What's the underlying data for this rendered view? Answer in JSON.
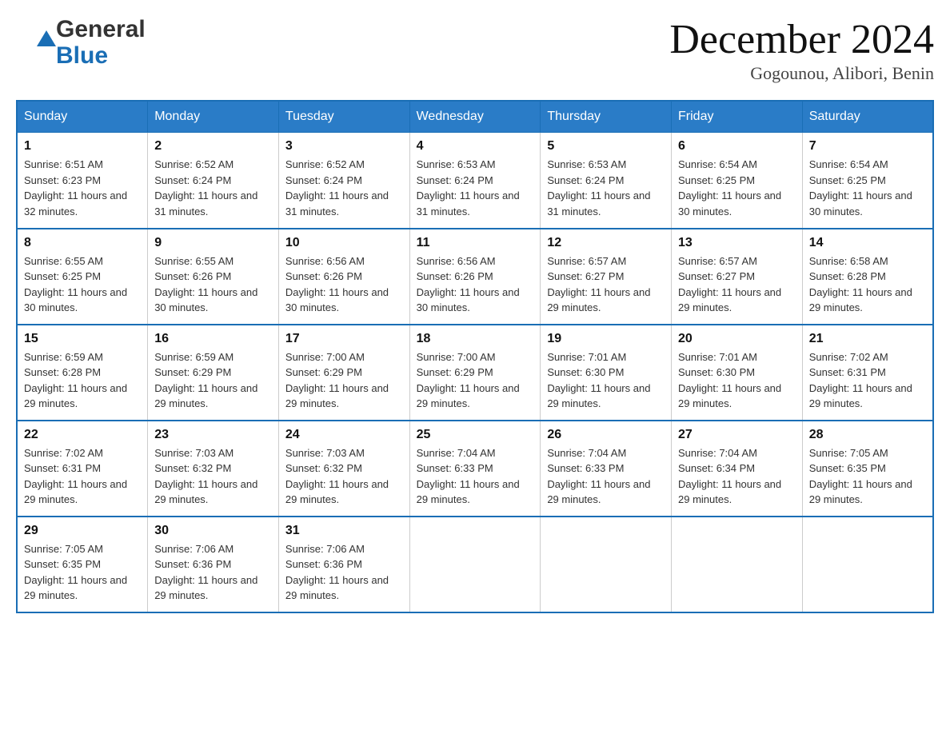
{
  "header": {
    "logo": {
      "general_text": "General",
      "blue_text": "Blue"
    },
    "month_title": "December 2024",
    "location": "Gogounou, Alibori, Benin"
  },
  "days_of_week": [
    "Sunday",
    "Monday",
    "Tuesday",
    "Wednesday",
    "Thursday",
    "Friday",
    "Saturday"
  ],
  "weeks": [
    [
      {
        "day": "1",
        "sunrise": "Sunrise: 6:51 AM",
        "sunset": "Sunset: 6:23 PM",
        "daylight": "Daylight: 11 hours and 32 minutes."
      },
      {
        "day": "2",
        "sunrise": "Sunrise: 6:52 AM",
        "sunset": "Sunset: 6:24 PM",
        "daylight": "Daylight: 11 hours and 31 minutes."
      },
      {
        "day": "3",
        "sunrise": "Sunrise: 6:52 AM",
        "sunset": "Sunset: 6:24 PM",
        "daylight": "Daylight: 11 hours and 31 minutes."
      },
      {
        "day": "4",
        "sunrise": "Sunrise: 6:53 AM",
        "sunset": "Sunset: 6:24 PM",
        "daylight": "Daylight: 11 hours and 31 minutes."
      },
      {
        "day": "5",
        "sunrise": "Sunrise: 6:53 AM",
        "sunset": "Sunset: 6:24 PM",
        "daylight": "Daylight: 11 hours and 31 minutes."
      },
      {
        "day": "6",
        "sunrise": "Sunrise: 6:54 AM",
        "sunset": "Sunset: 6:25 PM",
        "daylight": "Daylight: 11 hours and 30 minutes."
      },
      {
        "day": "7",
        "sunrise": "Sunrise: 6:54 AM",
        "sunset": "Sunset: 6:25 PM",
        "daylight": "Daylight: 11 hours and 30 minutes."
      }
    ],
    [
      {
        "day": "8",
        "sunrise": "Sunrise: 6:55 AM",
        "sunset": "Sunset: 6:25 PM",
        "daylight": "Daylight: 11 hours and 30 minutes."
      },
      {
        "day": "9",
        "sunrise": "Sunrise: 6:55 AM",
        "sunset": "Sunset: 6:26 PM",
        "daylight": "Daylight: 11 hours and 30 minutes."
      },
      {
        "day": "10",
        "sunrise": "Sunrise: 6:56 AM",
        "sunset": "Sunset: 6:26 PM",
        "daylight": "Daylight: 11 hours and 30 minutes."
      },
      {
        "day": "11",
        "sunrise": "Sunrise: 6:56 AM",
        "sunset": "Sunset: 6:26 PM",
        "daylight": "Daylight: 11 hours and 30 minutes."
      },
      {
        "day": "12",
        "sunrise": "Sunrise: 6:57 AM",
        "sunset": "Sunset: 6:27 PM",
        "daylight": "Daylight: 11 hours and 29 minutes."
      },
      {
        "day": "13",
        "sunrise": "Sunrise: 6:57 AM",
        "sunset": "Sunset: 6:27 PM",
        "daylight": "Daylight: 11 hours and 29 minutes."
      },
      {
        "day": "14",
        "sunrise": "Sunrise: 6:58 AM",
        "sunset": "Sunset: 6:28 PM",
        "daylight": "Daylight: 11 hours and 29 minutes."
      }
    ],
    [
      {
        "day": "15",
        "sunrise": "Sunrise: 6:59 AM",
        "sunset": "Sunset: 6:28 PM",
        "daylight": "Daylight: 11 hours and 29 minutes."
      },
      {
        "day": "16",
        "sunrise": "Sunrise: 6:59 AM",
        "sunset": "Sunset: 6:29 PM",
        "daylight": "Daylight: 11 hours and 29 minutes."
      },
      {
        "day": "17",
        "sunrise": "Sunrise: 7:00 AM",
        "sunset": "Sunset: 6:29 PM",
        "daylight": "Daylight: 11 hours and 29 minutes."
      },
      {
        "day": "18",
        "sunrise": "Sunrise: 7:00 AM",
        "sunset": "Sunset: 6:29 PM",
        "daylight": "Daylight: 11 hours and 29 minutes."
      },
      {
        "day": "19",
        "sunrise": "Sunrise: 7:01 AM",
        "sunset": "Sunset: 6:30 PM",
        "daylight": "Daylight: 11 hours and 29 minutes."
      },
      {
        "day": "20",
        "sunrise": "Sunrise: 7:01 AM",
        "sunset": "Sunset: 6:30 PM",
        "daylight": "Daylight: 11 hours and 29 minutes."
      },
      {
        "day": "21",
        "sunrise": "Sunrise: 7:02 AM",
        "sunset": "Sunset: 6:31 PM",
        "daylight": "Daylight: 11 hours and 29 minutes."
      }
    ],
    [
      {
        "day": "22",
        "sunrise": "Sunrise: 7:02 AM",
        "sunset": "Sunset: 6:31 PM",
        "daylight": "Daylight: 11 hours and 29 minutes."
      },
      {
        "day": "23",
        "sunrise": "Sunrise: 7:03 AM",
        "sunset": "Sunset: 6:32 PM",
        "daylight": "Daylight: 11 hours and 29 minutes."
      },
      {
        "day": "24",
        "sunrise": "Sunrise: 7:03 AM",
        "sunset": "Sunset: 6:32 PM",
        "daylight": "Daylight: 11 hours and 29 minutes."
      },
      {
        "day": "25",
        "sunrise": "Sunrise: 7:04 AM",
        "sunset": "Sunset: 6:33 PM",
        "daylight": "Daylight: 11 hours and 29 minutes."
      },
      {
        "day": "26",
        "sunrise": "Sunrise: 7:04 AM",
        "sunset": "Sunset: 6:33 PM",
        "daylight": "Daylight: 11 hours and 29 minutes."
      },
      {
        "day": "27",
        "sunrise": "Sunrise: 7:04 AM",
        "sunset": "Sunset: 6:34 PM",
        "daylight": "Daylight: 11 hours and 29 minutes."
      },
      {
        "day": "28",
        "sunrise": "Sunrise: 7:05 AM",
        "sunset": "Sunset: 6:35 PM",
        "daylight": "Daylight: 11 hours and 29 minutes."
      }
    ],
    [
      {
        "day": "29",
        "sunrise": "Sunrise: 7:05 AM",
        "sunset": "Sunset: 6:35 PM",
        "daylight": "Daylight: 11 hours and 29 minutes."
      },
      {
        "day": "30",
        "sunrise": "Sunrise: 7:06 AM",
        "sunset": "Sunset: 6:36 PM",
        "daylight": "Daylight: 11 hours and 29 minutes."
      },
      {
        "day": "31",
        "sunrise": "Sunrise: 7:06 AM",
        "sunset": "Sunset: 6:36 PM",
        "daylight": "Daylight: 11 hours and 29 minutes."
      },
      null,
      null,
      null,
      null
    ]
  ]
}
